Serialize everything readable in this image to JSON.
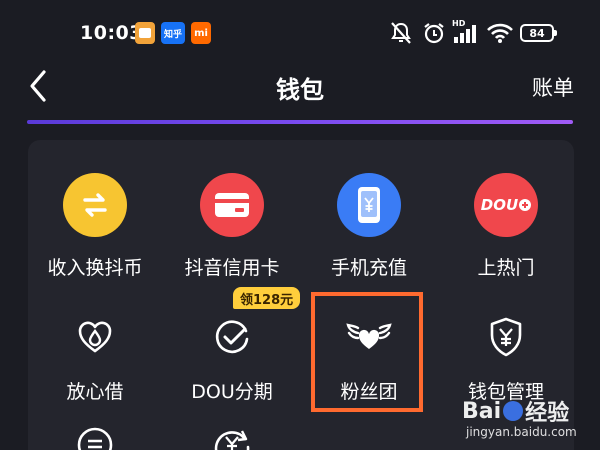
{
  "status_bar": {
    "time": "10:03",
    "app_badge_zhihu": "知乎",
    "app_badge_mi": "mi",
    "network_label": "HD",
    "battery": "84"
  },
  "header": {
    "title": "钱包",
    "bill_label": "账单"
  },
  "grid": {
    "items": [
      {
        "label": "收入换抖币",
        "icon": "exchange-arrows-icon",
        "color": "#f7c531"
      },
      {
        "label": "抖音信用卡",
        "icon": "credit-card-icon",
        "color": "#f0474c"
      },
      {
        "label": "手机充值",
        "icon": "phone-yuan-icon",
        "color": "#3a7cf5"
      },
      {
        "label": "上热门",
        "icon": "dou-plus-icon",
        "color": "#f0474c",
        "icon_text": "DOU"
      },
      {
        "label": "放心借",
        "icon": "heart-drop-icon"
      },
      {
        "label": "DOU分期",
        "icon": "check-circle-icon"
      },
      {
        "label": "粉丝团",
        "icon": "winged-heart-icon"
      },
      {
        "label": "钱包管理",
        "icon": "shield-yuan-icon"
      }
    ],
    "promo_badge": "领128元"
  },
  "watermark": {
    "brand": "Bai",
    "brand_suffix": "经验",
    "url": "jingyan.baidu.com"
  }
}
